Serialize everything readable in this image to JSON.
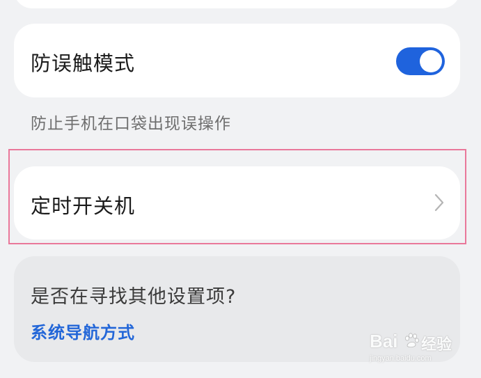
{
  "settings": {
    "anti_mistouch": {
      "label": "防误触模式",
      "enabled": true,
      "description": "防止手机在口袋出现误操作"
    },
    "scheduled_power": {
      "label": "定时开关机"
    }
  },
  "suggestion": {
    "title": "是否在寻找其他设置项?",
    "link_label": "系统导航方式"
  },
  "watermark": {
    "brand_left": "Bai",
    "brand_right": "经验",
    "url": "jingyan.baidu.com"
  },
  "colors": {
    "accent": "#1f63dd",
    "link": "#2266d8",
    "highlight_border": "#e9789a",
    "background": "#f1f2f4"
  },
  "icons": {
    "chevron": "chevron-right-icon",
    "watermark_paw": "baidu-paw-icon"
  }
}
